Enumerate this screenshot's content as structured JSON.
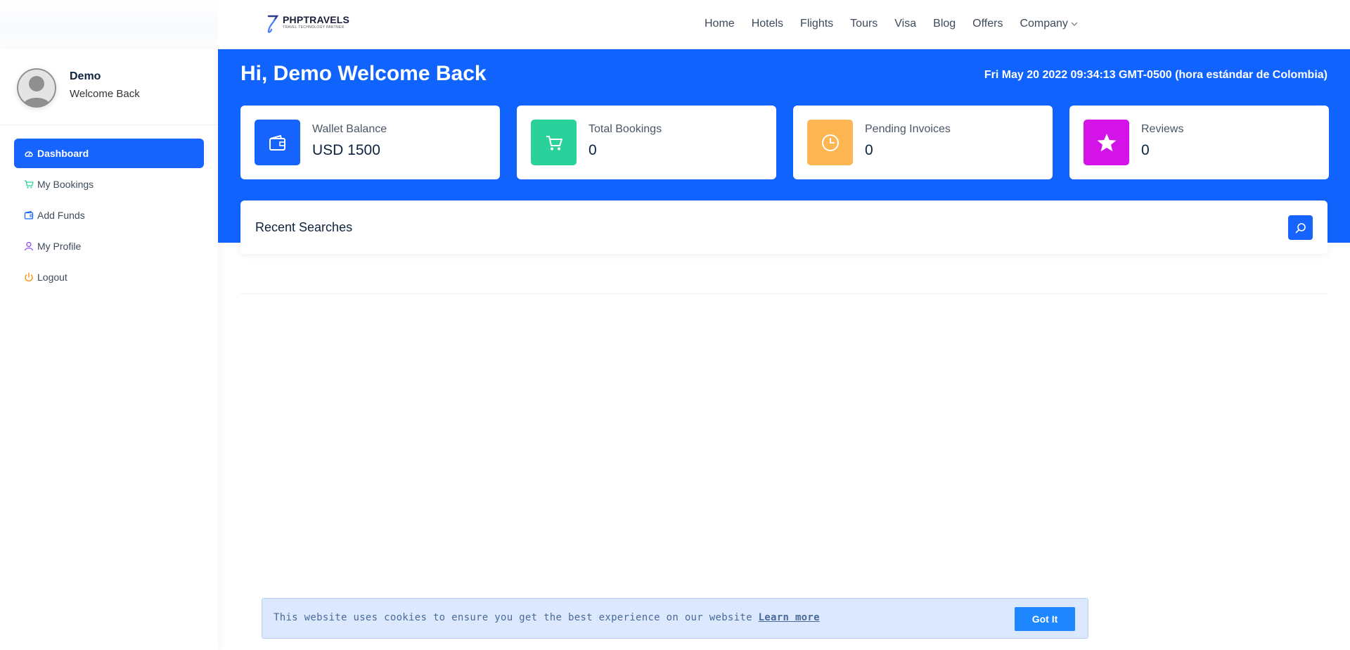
{
  "header": {
    "logo": {
      "name": "PHPTRAVELS",
      "tagline": "TRAVEL TECHNOLOGY PARTNER"
    },
    "nav": [
      {
        "label": "Home"
      },
      {
        "label": "Hotels"
      },
      {
        "label": "Flights"
      },
      {
        "label": "Tours"
      },
      {
        "label": "Visa"
      },
      {
        "label": "Blog"
      },
      {
        "label": "Offers"
      },
      {
        "label": "Company"
      }
    ]
  },
  "sidebar": {
    "profile": {
      "name": "Demo",
      "subtitle": "Welcome Back"
    },
    "items": [
      {
        "label": "Dashboard",
        "icon": "dashboard-icon",
        "active": true
      },
      {
        "label": "My Bookings",
        "icon": "cart-icon",
        "color": "#2ad19a"
      },
      {
        "label": "Add Funds",
        "icon": "wallet-icon",
        "color": "#1763fd"
      },
      {
        "label": "My Profile",
        "icon": "user-icon",
        "color": "#8a3ffc"
      },
      {
        "label": "Logout",
        "icon": "power-icon",
        "color": "#ff8a00"
      }
    ]
  },
  "main": {
    "greeting": "Hi, Demo Welcome Back",
    "datetime": "Fri May 20 2022 09:34:13 GMT-0500 (hora estándar de Colombia)",
    "cards": [
      {
        "label": "Wallet Balance",
        "value": "USD 1500",
        "icon": "wallet-icon",
        "color": "#1763fd"
      },
      {
        "label": "Total Bookings",
        "value": "0",
        "icon": "cart-icon",
        "color": "#2ad19a"
      },
      {
        "label": "Pending Invoices",
        "value": "0",
        "icon": "clock-icon",
        "color": "#fdb652"
      },
      {
        "label": "Reviews",
        "value": "0",
        "icon": "star-icon",
        "color": "#d413e9"
      }
    ],
    "recent_searches": {
      "title": "Recent Searches",
      "button_icon": "search-icon"
    }
  },
  "cookie": {
    "text": "This website uses cookies to ensure you get the best experience on our website",
    "link": "Learn more",
    "button": "Got It"
  },
  "colors": {
    "brand_blue": "#1163fe",
    "accent_blue": "#1763fd",
    "cookie_bg": "#dce8fd"
  }
}
